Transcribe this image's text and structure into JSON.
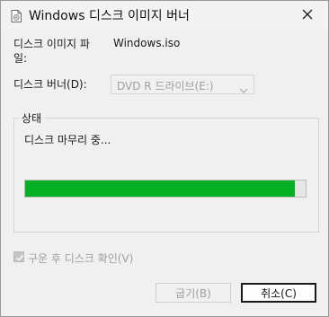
{
  "window": {
    "title": "Windows 디스크 이미지 버너"
  },
  "form": {
    "file_label": "디스크 이미지 파일:",
    "file_value": "Windows.iso",
    "drive_label": "디스크 버너(D):",
    "drive_value": "DVD R 드라이브(E:)"
  },
  "status_group": {
    "title": "상태",
    "status_text": "디스크 마무리 중...",
    "progress_percent": 96
  },
  "verify": {
    "label": "구운 후 디스크 확인(V)",
    "checked": true,
    "enabled": false
  },
  "buttons": {
    "burn_label": "굽기(B)",
    "cancel_label": "취소(C)"
  },
  "colors": {
    "progress_fill": "#06b025",
    "disabled_text": "#a0a0a0"
  },
  "icons": {
    "title": "disc-image-icon",
    "close": "close-icon",
    "dropdown": "chevron-down-icon",
    "checkbox": "checkmark-icon"
  }
}
